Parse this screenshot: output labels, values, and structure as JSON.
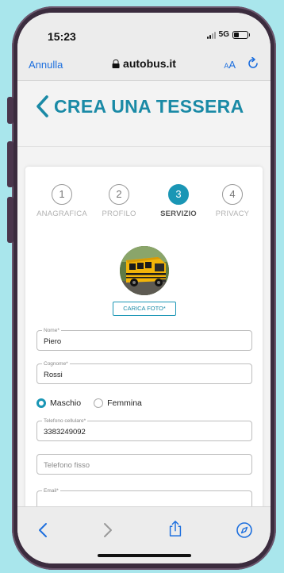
{
  "status_bar": {
    "time": "15:23",
    "network": "5G"
  },
  "browser": {
    "cancel_label": "Annulla",
    "url": "autobus.it",
    "text_size_label": "AA"
  },
  "page": {
    "title": "CREA UNA TESSERA"
  },
  "stepper": {
    "steps": [
      {
        "number": "1",
        "label": "ANAGRAFICA"
      },
      {
        "number": "2",
        "label": "PROFILO"
      },
      {
        "number": "3",
        "label": "SERVIZIO"
      },
      {
        "number": "4",
        "label": "PRIVACY"
      }
    ],
    "active_step": "3"
  },
  "form": {
    "upload_photo_label": "CARICA FOTO*",
    "first_name": {
      "label": "Nome*",
      "value": "Piero"
    },
    "last_name": {
      "label": "Cognome*",
      "value": "Rossi"
    },
    "gender": {
      "options": [
        "Maschio",
        "Femmina"
      ],
      "selected": "Maschio"
    },
    "mobile": {
      "label": "Telefono cellulare*",
      "value": "3383249092"
    },
    "landline": {
      "placeholder": "Telefono fisso"
    },
    "email": {
      "label": "Email*",
      "value": ""
    }
  },
  "colors": {
    "accent": "#1a96b5",
    "title": "#1a8aa6",
    "ios_blue": "#1d6fde",
    "background": "#a9e6ec",
    "frame": "#3b2c3e"
  },
  "icons": [
    "lock-icon",
    "reload-icon",
    "back-chevron-icon",
    "bus-photo",
    "browser-back-icon",
    "browser-forward-icon",
    "share-icon",
    "compass-icon"
  ]
}
